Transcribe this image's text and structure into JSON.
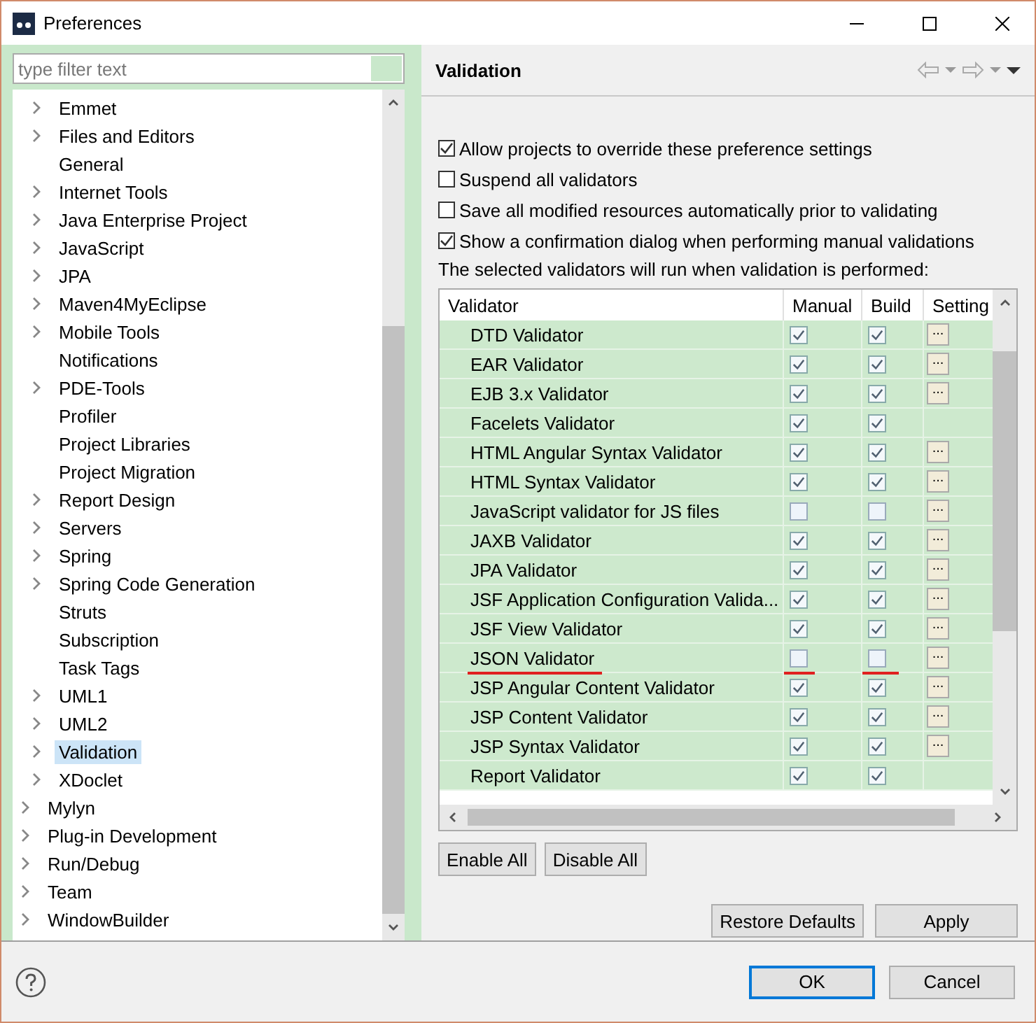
{
  "window": {
    "title": "Preferences"
  },
  "filter": {
    "placeholder": "type filter text"
  },
  "tree": [
    {
      "children": [
        {
          "label": "Emmet",
          "expandable": true,
          "selected": false
        },
        {
          "label": "Files and Editors",
          "expandable": true,
          "selected": false
        },
        {
          "label": "General",
          "expandable": false,
          "selected": false
        },
        {
          "label": "Internet Tools",
          "expandable": true,
          "selected": false
        },
        {
          "label": "Java Enterprise Project",
          "expandable": true,
          "selected": false
        },
        {
          "label": "JavaScript",
          "expandable": true,
          "selected": false
        },
        {
          "label": "JPA",
          "expandable": true,
          "selected": false
        },
        {
          "label": "Maven4MyEclipse",
          "expandable": true,
          "selected": false
        },
        {
          "label": "Mobile Tools",
          "expandable": true,
          "selected": false
        },
        {
          "label": "Notifications",
          "expandable": false,
          "selected": false
        },
        {
          "label": "PDE-Tools",
          "expandable": true,
          "selected": false
        },
        {
          "label": "Profiler",
          "expandable": false,
          "selected": false
        },
        {
          "label": "Project Libraries",
          "expandable": false,
          "selected": false
        },
        {
          "label": "Project Migration",
          "expandable": false,
          "selected": false
        },
        {
          "label": "Report Design",
          "expandable": true,
          "selected": false
        },
        {
          "label": "Servers",
          "expandable": true,
          "selected": false
        },
        {
          "label": "Spring",
          "expandable": true,
          "selected": false
        },
        {
          "label": "Spring Code Generation",
          "expandable": true,
          "selected": false
        },
        {
          "label": "Struts",
          "expandable": false,
          "selected": false
        },
        {
          "label": "Subscription",
          "expandable": false,
          "selected": false
        },
        {
          "label": "Task Tags",
          "expandable": false,
          "selected": false
        },
        {
          "label": "UML1",
          "expandable": true,
          "selected": false
        },
        {
          "label": "UML2",
          "expandable": true,
          "selected": false
        },
        {
          "label": "Validation",
          "expandable": true,
          "selected": true
        },
        {
          "label": "XDoclet",
          "expandable": true,
          "selected": false
        }
      ]
    },
    {
      "label": "Mylyn",
      "expandable": true,
      "selected": false
    },
    {
      "label": "Plug-in Development",
      "expandable": true,
      "selected": false
    },
    {
      "label": "Run/Debug",
      "expandable": true,
      "selected": false
    },
    {
      "label": "Team",
      "expandable": true,
      "selected": false
    },
    {
      "label": "WindowBuilder",
      "expandable": true,
      "selected": false
    }
  ],
  "page": {
    "title": "Validation"
  },
  "options": [
    {
      "label": "Allow projects to override these preference settings",
      "checked": true
    },
    {
      "label": "Suspend all validators",
      "checked": false
    },
    {
      "label": "Save all modified resources automatically prior to validating",
      "checked": false
    },
    {
      "label": "Show a confirmation dialog when performing manual validations",
      "checked": true
    }
  ],
  "table_caption": "The selected validators will run when validation is performed:",
  "table": {
    "columns": [
      "Validator",
      "Manual",
      "Build",
      "Setting"
    ],
    "rows": [
      {
        "name": "DTD Validator",
        "manual": true,
        "build": true,
        "settings": true,
        "underlined": false
      },
      {
        "name": "EAR Validator",
        "manual": true,
        "build": true,
        "settings": true,
        "underlined": false
      },
      {
        "name": "EJB 3.x Validator",
        "manual": true,
        "build": true,
        "settings": true,
        "underlined": false
      },
      {
        "name": "Facelets Validator",
        "manual": true,
        "build": true,
        "settings": false,
        "underlined": false
      },
      {
        "name": "HTML Angular Syntax Validator",
        "manual": true,
        "build": true,
        "settings": true,
        "underlined": false
      },
      {
        "name": "HTML Syntax Validator",
        "manual": true,
        "build": true,
        "settings": true,
        "underlined": false
      },
      {
        "name": "JavaScript validator for JS files",
        "manual": false,
        "build": false,
        "settings": true,
        "underlined": false
      },
      {
        "name": "JAXB Validator",
        "manual": true,
        "build": true,
        "settings": true,
        "underlined": false
      },
      {
        "name": "JPA Validator",
        "manual": true,
        "build": true,
        "settings": true,
        "underlined": false
      },
      {
        "name": "JSF Application Configuration Valida...",
        "manual": true,
        "build": true,
        "settings": true,
        "underlined": false
      },
      {
        "name": "JSF View Validator",
        "manual": true,
        "build": true,
        "settings": true,
        "underlined": false
      },
      {
        "name": "JSON Validator",
        "manual": false,
        "build": false,
        "settings": true,
        "underlined": true
      },
      {
        "name": "JSP Angular Content Validator",
        "manual": true,
        "build": true,
        "settings": true,
        "underlined": false
      },
      {
        "name": "JSP Content Validator",
        "manual": true,
        "build": true,
        "settings": true,
        "underlined": false
      },
      {
        "name": "JSP Syntax Validator",
        "manual": true,
        "build": true,
        "settings": true,
        "underlined": false
      },
      {
        "name": "Report Validator",
        "manual": true,
        "build": true,
        "settings": false,
        "underlined": false
      }
    ]
  },
  "settings_label": "...",
  "table_buttons": [
    "Enable All",
    "Disable All"
  ],
  "page_buttons": [
    "Restore Defaults",
    "Apply"
  ],
  "dialog_buttons": [
    {
      "label": "OK",
      "default": true
    },
    {
      "label": "Cancel",
      "default": false
    }
  ]
}
